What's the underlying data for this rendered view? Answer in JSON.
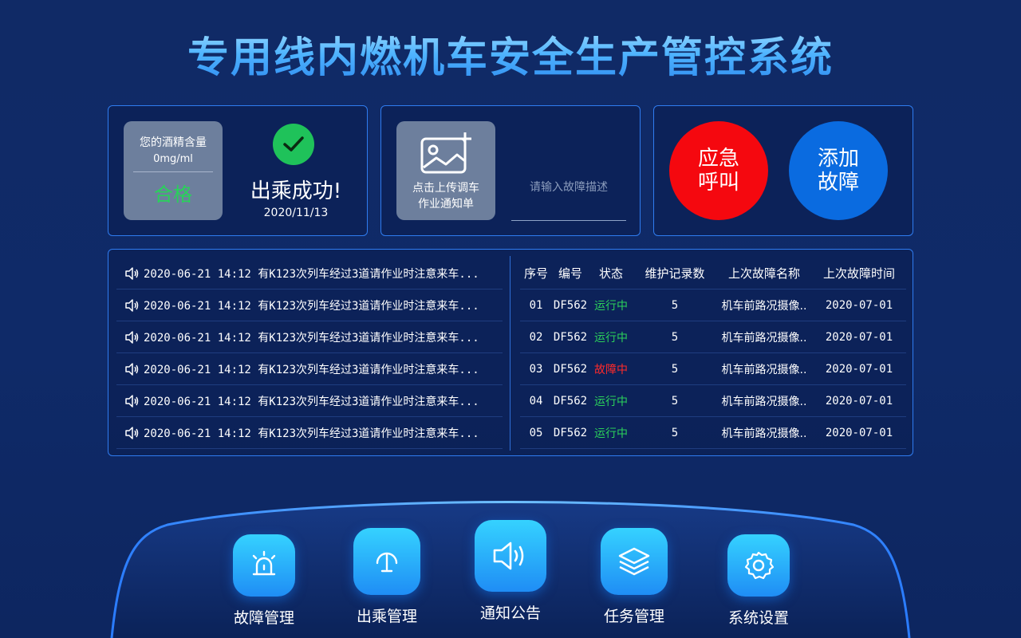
{
  "title": "专用线内燃机车安全生产管控系统",
  "alcohol": {
    "label": "您的酒精含量",
    "value": "0mg/ml",
    "result": "合格"
  },
  "boarding": {
    "status": "出乘成功!",
    "date": "2020/11/13"
  },
  "upload": {
    "line1": "点击上传调车",
    "line2": "作业通知单",
    "placeholder": "请输入故障描述"
  },
  "actions": {
    "emergency_l1": "应急",
    "emergency_l2": "呼叫",
    "addfault_l1": "添加",
    "addfault_l2": "故障"
  },
  "notices": [
    "2020-06-21 14:12 有K123次列车经过3道请作业时注意来车...",
    "2020-06-21 14:12 有K123次列车经过3道请作业时注意来车...",
    "2020-06-21 14:12 有K123次列车经过3道请作业时注意来车...",
    "2020-06-21 14:12 有K123次列车经过3道请作业时注意来车...",
    "2020-06-21 14:12 有K123次列车经过3道请作业时注意来车...",
    "2020-06-21 14:12 有K123次列车经过3道请作业时注意来车..."
  ],
  "table": {
    "headers": [
      "序号",
      "编号",
      "状态",
      "维护记录数",
      "上次故障名称",
      "上次故障时间"
    ],
    "rows": [
      {
        "no": "01",
        "id": "DF562",
        "status": "运行中",
        "status_type": "ok",
        "records": "5",
        "fault": "机车前路况摄像..",
        "time": "2020-07-01"
      },
      {
        "no": "02",
        "id": "DF562",
        "status": "运行中",
        "status_type": "ok",
        "records": "5",
        "fault": "机车前路况摄像..",
        "time": "2020-07-01"
      },
      {
        "no": "03",
        "id": "DF562",
        "status": "故障中",
        "status_type": "bad",
        "records": "5",
        "fault": "机车前路况摄像..",
        "time": "2020-07-01"
      },
      {
        "no": "04",
        "id": "DF562",
        "status": "运行中",
        "status_type": "ok",
        "records": "5",
        "fault": "机车前路况摄像..",
        "time": "2020-07-01"
      },
      {
        "no": "05",
        "id": "DF562",
        "status": "运行中",
        "status_type": "ok",
        "records": "5",
        "fault": "机车前路况摄像..",
        "time": "2020-07-01"
      }
    ]
  },
  "nav": [
    {
      "label": "故障管理",
      "icon": "alarm-light-icon"
    },
    {
      "label": "出乘管理",
      "icon": "gauge-icon"
    },
    {
      "label": "通知公告",
      "icon": "speaker-icon"
    },
    {
      "label": "任务管理",
      "icon": "layers-icon"
    },
    {
      "label": "系统设置",
      "icon": "gear-icon"
    }
  ],
  "colors": {
    "accent": "#2f7cf0",
    "ok": "#2bd15a",
    "bad": "#ff2a2a",
    "emergency": "#f5080f",
    "addfault": "#0a6be0"
  }
}
